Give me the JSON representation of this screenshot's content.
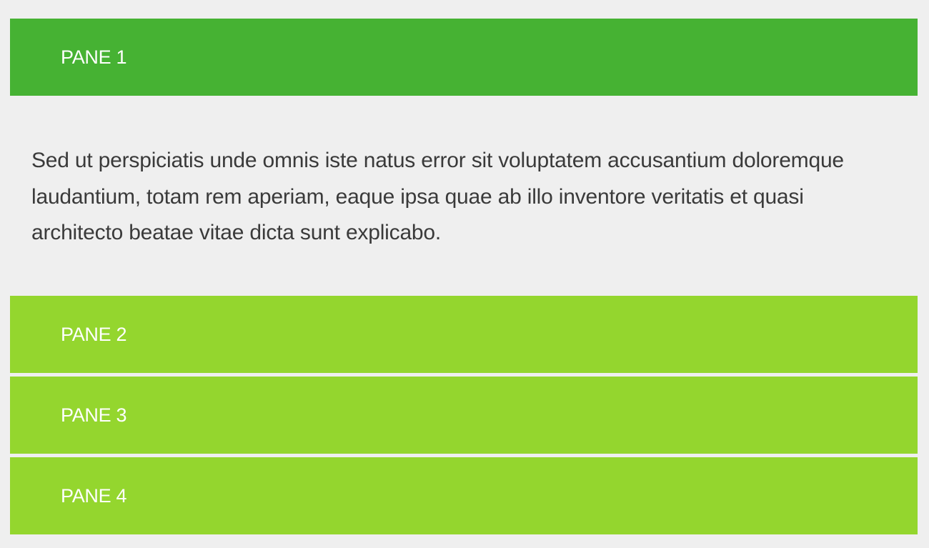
{
  "accordion": {
    "panes": [
      {
        "title": "PANE 1",
        "content": "Sed ut perspiciatis unde omnis iste natus error sit voluptatem accusantium doloremque laudantium, totam rem aperiam, eaque ipsa quae ab illo inventore veritatis et quasi architecto beatae vitae dicta sunt explicabo."
      },
      {
        "title": "PANE 2"
      },
      {
        "title": "PANE 3"
      },
      {
        "title": "PANE 4"
      }
    ],
    "active_index": 0
  },
  "colors": {
    "active_header": "#46b233",
    "inactive_header": "#94d62e",
    "background": "#efefef",
    "body_text": "#3a3a3a",
    "header_text": "#ffffff"
  }
}
